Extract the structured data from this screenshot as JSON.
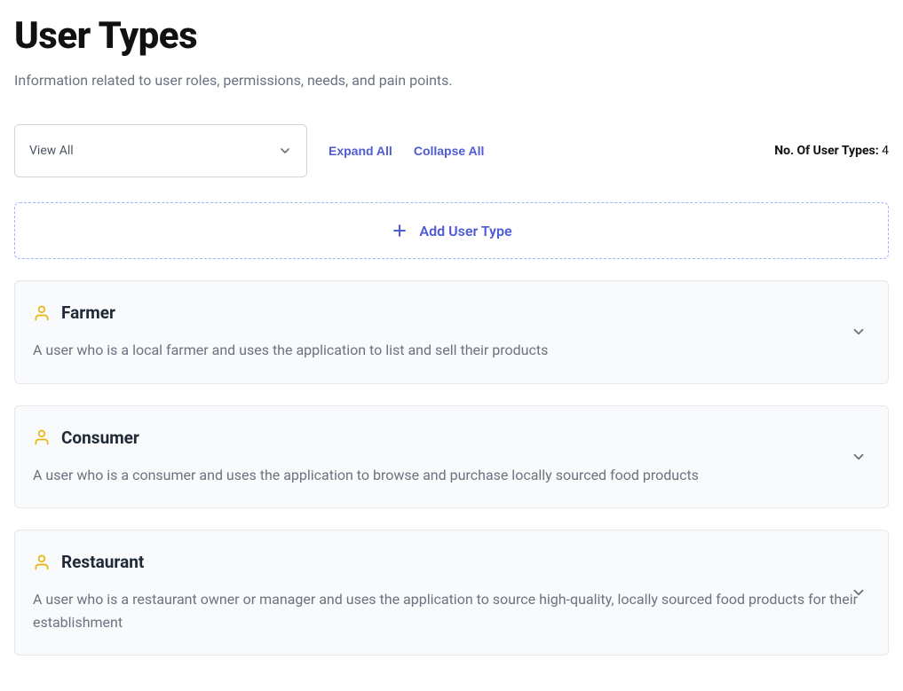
{
  "header": {
    "title": "User Types",
    "subtitle": "Information related to user roles, permissions, needs, and pain points."
  },
  "controls": {
    "filter_label": "View All",
    "expand_all": "Expand All",
    "collapse_all": "Collapse All",
    "count_prefix": "No. Of User Types: ",
    "count_value": "4"
  },
  "add_button": {
    "label": "Add User Type"
  },
  "user_types": [
    {
      "name": "Farmer",
      "description": "A user who is a local farmer and uses the application to list and sell their products"
    },
    {
      "name": "Consumer",
      "description": "A user who is a consumer and uses the application to browse and purchase locally sourced food products"
    },
    {
      "name": "Restaurant",
      "description": "A user who is a restaurant owner or manager and uses the application to source high-quality, locally sourced food products for their establishment"
    }
  ]
}
